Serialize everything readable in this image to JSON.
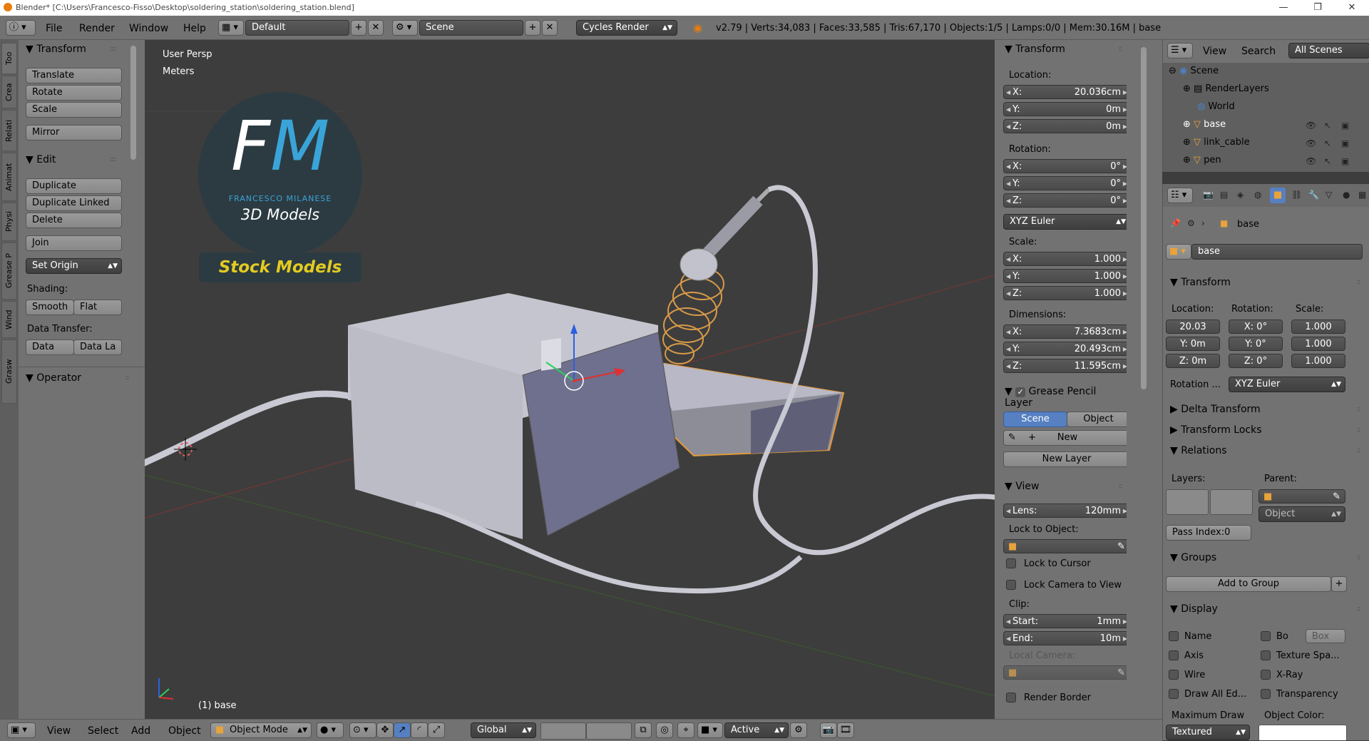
{
  "title": "Blender* [C:\\Users\\Francesco-Fisso\\Desktop\\soldering_station\\soldering_station.blend]",
  "window_controls": [
    "—",
    "❐",
    "✕"
  ],
  "menus": [
    "File",
    "Render",
    "Window",
    "Help"
  ],
  "screen_layout": "Default",
  "scene": "Scene",
  "render_engine": "Cycles Render",
  "stats": "v2.79 | Verts:34,083 | Faces:33,585 | Tris:67,170 | Objects:1/5 | Lamps:0/0 | Mem:30.16M | base",
  "left_tabs": [
    "Too",
    "Crea",
    "Relati",
    "Animat",
    "Physi",
    "Grease P",
    "Wind",
    "Grasw"
  ],
  "tools": {
    "transform_header": "Transform",
    "translate": "Translate",
    "rotate": "Rotate",
    "scale": "Scale",
    "mirror": "Mirror",
    "edit_header": "Edit",
    "duplicate": "Duplicate",
    "duplicate_linked": "Duplicate Linked",
    "delete": "Delete",
    "join": "Join",
    "set_origin": "Set Origin",
    "shading_label": "Shading:",
    "smooth": "Smooth",
    "flat": "Flat",
    "data_transfer_label": "Data Transfer:",
    "data": "Data",
    "data_la": "Data La",
    "operator_header": "Operator"
  },
  "viewport": {
    "view_name": "User Persp",
    "units": "Meters",
    "object_label": "(1) base",
    "logo": {
      "letters": "FM",
      "name": "FRANCESCO MILANESE",
      "sub": "3D Models",
      "stock": "Stock Models"
    },
    "colors": {
      "bg": "#3d3d3d",
      "grid": "#474747"
    }
  },
  "n_panel": {
    "transform_header": "Transform",
    "location_label": "Location:",
    "loc": [
      {
        "l": "X:",
        "v": "20.036cm"
      },
      {
        "l": "Y:",
        "v": "0m"
      },
      {
        "l": "Z:",
        "v": "0m"
      }
    ],
    "rotation_label": "Rotation:",
    "rot": [
      {
        "l": "X:",
        "v": "0°"
      },
      {
        "l": "Y:",
        "v": "0°"
      },
      {
        "l": "Z:",
        "v": "0°"
      }
    ],
    "rot_mode": "XYZ Euler",
    "scale_label": "Scale:",
    "scl": [
      {
        "l": "X:",
        "v": "1.000"
      },
      {
        "l": "Y:",
        "v": "1.000"
      },
      {
        "l": "Z:",
        "v": "1.000"
      }
    ],
    "dimensions_label": "Dimensions:",
    "dim": [
      {
        "l": "X:",
        "v": "7.3683cm"
      },
      {
        "l": "Y:",
        "v": "20.493cm"
      },
      {
        "l": "Z:",
        "v": "11.595cm"
      }
    ],
    "grease_header": "Grease Pencil Layer",
    "scene_tab": "Scene",
    "object_tab": "Object",
    "new": "New",
    "new_layer": "New Layer",
    "view_header": "View",
    "lens_label": "Lens:",
    "lens_value": "120mm",
    "lock_to_object": "Lock to Object:",
    "lock_to_cursor": "Lock to Cursor",
    "lock_camera": "Lock Camera to View",
    "clip_label": "Clip:",
    "clip_start_label": "Start:",
    "clip_start": "1mm",
    "clip_end_label": "End:",
    "clip_end": "10m",
    "local_camera": "Local Camera:",
    "render_border": "Render Border"
  },
  "outliner": {
    "view": "View",
    "search": "Search",
    "all_scenes": "All Scenes",
    "items": [
      "Scene",
      "RenderLayers",
      "World",
      "base",
      "link_cable",
      "pen"
    ]
  },
  "properties": {
    "breadcrumb": "base",
    "object_name": "base",
    "transform_header": "Transform",
    "location_label": "Location:",
    "rotation_label": "Rotation:",
    "scale_label": "Scale:",
    "loc": [
      "20.03",
      "Y: 0m",
      "Z: 0m"
    ],
    "rot": [
      "X:  0°",
      "Y:  0°",
      "Z:  0°"
    ],
    "scl": [
      "1.000",
      "1.000",
      "1.000"
    ],
    "rotation_mode_label": "Rotation ...",
    "rotation_mode": "XYZ Euler",
    "delta_transform": "Delta Transform",
    "transform_locks": "Transform Locks",
    "relations": "Relations",
    "layers_label": "Layers:",
    "parent_label": "Parent:",
    "parent_type": "Object",
    "pass_index": "Pass Index:0",
    "groups": "Groups",
    "add_to_group": "Add to Group",
    "display": "Display",
    "name": "Name",
    "bo": "Bo",
    "box": "Box",
    "axis": "Axis",
    "texture_space": "Texture Spa...",
    "wire": "Wire",
    "xray": "X-Ray",
    "draw_all_edges": "Draw All Ed...",
    "transparency": "Transparency",
    "maximum_draw": "Maximum Draw",
    "object_color": "Object Color:",
    "textured": "Textured"
  },
  "bottom": {
    "view": "View",
    "select": "Select",
    "add": "Add",
    "object": "Object",
    "mode": "Object Mode",
    "orientation": "Global",
    "pivot": "Active"
  }
}
